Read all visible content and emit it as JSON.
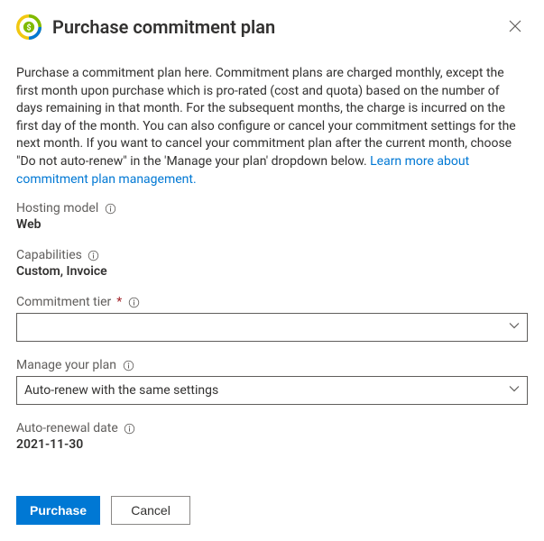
{
  "header": {
    "title": "Purchase commitment plan"
  },
  "description": {
    "text": "Purchase a commitment plan here. Commitment plans are charged monthly, except the first month upon purchase which is pro-rated (cost and quota) based on the number of days remaining in that month. For the subsequent months, the charge is incurred on the first day of the month. You can also configure or cancel your commitment settings for the next month. If you want to cancel your commitment plan after the current month, choose \"Do not auto-renew\" in the 'Manage your plan' dropdown below. ",
    "link_text": "Learn more about commitment plan management."
  },
  "fields": {
    "hosting_model": {
      "label": "Hosting model",
      "value": "Web"
    },
    "capabilities": {
      "label": "Capabilities",
      "value": "Custom, Invoice"
    },
    "commitment_tier": {
      "label": "Commitment tier",
      "required_marker": "*",
      "selected": ""
    },
    "manage_plan": {
      "label": "Manage your plan",
      "selected": "Auto-renew with the same settings"
    },
    "auto_renewal_date": {
      "label": "Auto-renewal date",
      "value": "2021-11-30"
    }
  },
  "footer": {
    "primary": "Purchase",
    "secondary": "Cancel"
  }
}
